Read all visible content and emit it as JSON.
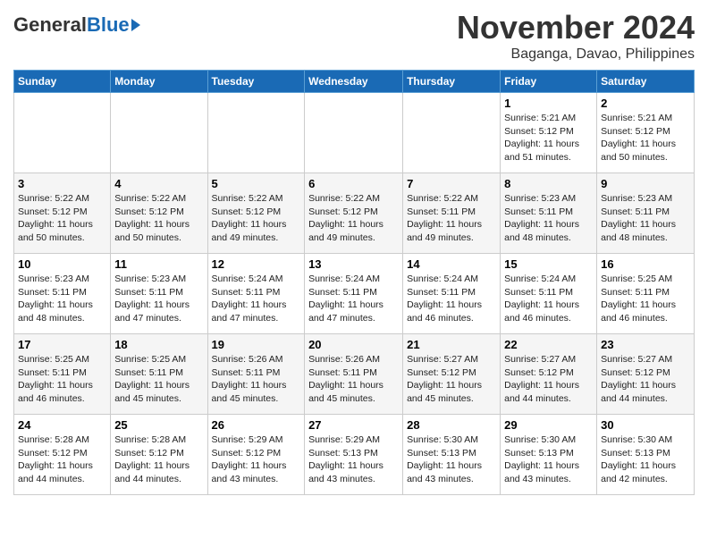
{
  "header": {
    "logo_general": "General",
    "logo_blue": "Blue",
    "title": "November 2024",
    "subtitle": "Baganga, Davao, Philippines"
  },
  "columns": [
    "Sunday",
    "Monday",
    "Tuesday",
    "Wednesday",
    "Thursday",
    "Friday",
    "Saturday"
  ],
  "weeks": [
    [
      {
        "day": "",
        "info": ""
      },
      {
        "day": "",
        "info": ""
      },
      {
        "day": "",
        "info": ""
      },
      {
        "day": "",
        "info": ""
      },
      {
        "day": "",
        "info": ""
      },
      {
        "day": "1",
        "info": "Sunrise: 5:21 AM\nSunset: 5:12 PM\nDaylight: 11 hours and 51 minutes."
      },
      {
        "day": "2",
        "info": "Sunrise: 5:21 AM\nSunset: 5:12 PM\nDaylight: 11 hours and 50 minutes."
      }
    ],
    [
      {
        "day": "3",
        "info": "Sunrise: 5:22 AM\nSunset: 5:12 PM\nDaylight: 11 hours and 50 minutes."
      },
      {
        "day": "4",
        "info": "Sunrise: 5:22 AM\nSunset: 5:12 PM\nDaylight: 11 hours and 50 minutes."
      },
      {
        "day": "5",
        "info": "Sunrise: 5:22 AM\nSunset: 5:12 PM\nDaylight: 11 hours and 49 minutes."
      },
      {
        "day": "6",
        "info": "Sunrise: 5:22 AM\nSunset: 5:12 PM\nDaylight: 11 hours and 49 minutes."
      },
      {
        "day": "7",
        "info": "Sunrise: 5:22 AM\nSunset: 5:11 PM\nDaylight: 11 hours and 49 minutes."
      },
      {
        "day": "8",
        "info": "Sunrise: 5:23 AM\nSunset: 5:11 PM\nDaylight: 11 hours and 48 minutes."
      },
      {
        "day": "9",
        "info": "Sunrise: 5:23 AM\nSunset: 5:11 PM\nDaylight: 11 hours and 48 minutes."
      }
    ],
    [
      {
        "day": "10",
        "info": "Sunrise: 5:23 AM\nSunset: 5:11 PM\nDaylight: 11 hours and 48 minutes."
      },
      {
        "day": "11",
        "info": "Sunrise: 5:23 AM\nSunset: 5:11 PM\nDaylight: 11 hours and 47 minutes."
      },
      {
        "day": "12",
        "info": "Sunrise: 5:24 AM\nSunset: 5:11 PM\nDaylight: 11 hours and 47 minutes."
      },
      {
        "day": "13",
        "info": "Sunrise: 5:24 AM\nSunset: 5:11 PM\nDaylight: 11 hours and 47 minutes."
      },
      {
        "day": "14",
        "info": "Sunrise: 5:24 AM\nSunset: 5:11 PM\nDaylight: 11 hours and 46 minutes."
      },
      {
        "day": "15",
        "info": "Sunrise: 5:24 AM\nSunset: 5:11 PM\nDaylight: 11 hours and 46 minutes."
      },
      {
        "day": "16",
        "info": "Sunrise: 5:25 AM\nSunset: 5:11 PM\nDaylight: 11 hours and 46 minutes."
      }
    ],
    [
      {
        "day": "17",
        "info": "Sunrise: 5:25 AM\nSunset: 5:11 PM\nDaylight: 11 hours and 46 minutes."
      },
      {
        "day": "18",
        "info": "Sunrise: 5:25 AM\nSunset: 5:11 PM\nDaylight: 11 hours and 45 minutes."
      },
      {
        "day": "19",
        "info": "Sunrise: 5:26 AM\nSunset: 5:11 PM\nDaylight: 11 hours and 45 minutes."
      },
      {
        "day": "20",
        "info": "Sunrise: 5:26 AM\nSunset: 5:11 PM\nDaylight: 11 hours and 45 minutes."
      },
      {
        "day": "21",
        "info": "Sunrise: 5:27 AM\nSunset: 5:12 PM\nDaylight: 11 hours and 45 minutes."
      },
      {
        "day": "22",
        "info": "Sunrise: 5:27 AM\nSunset: 5:12 PM\nDaylight: 11 hours and 44 minutes."
      },
      {
        "day": "23",
        "info": "Sunrise: 5:27 AM\nSunset: 5:12 PM\nDaylight: 11 hours and 44 minutes."
      }
    ],
    [
      {
        "day": "24",
        "info": "Sunrise: 5:28 AM\nSunset: 5:12 PM\nDaylight: 11 hours and 44 minutes."
      },
      {
        "day": "25",
        "info": "Sunrise: 5:28 AM\nSunset: 5:12 PM\nDaylight: 11 hours and 44 minutes."
      },
      {
        "day": "26",
        "info": "Sunrise: 5:29 AM\nSunset: 5:12 PM\nDaylight: 11 hours and 43 minutes."
      },
      {
        "day": "27",
        "info": "Sunrise: 5:29 AM\nSunset: 5:13 PM\nDaylight: 11 hours and 43 minutes."
      },
      {
        "day": "28",
        "info": "Sunrise: 5:30 AM\nSunset: 5:13 PM\nDaylight: 11 hours and 43 minutes."
      },
      {
        "day": "29",
        "info": "Sunrise: 5:30 AM\nSunset: 5:13 PM\nDaylight: 11 hours and 43 minutes."
      },
      {
        "day": "30",
        "info": "Sunrise: 5:30 AM\nSunset: 5:13 PM\nDaylight: 11 hours and 42 minutes."
      }
    ]
  ]
}
